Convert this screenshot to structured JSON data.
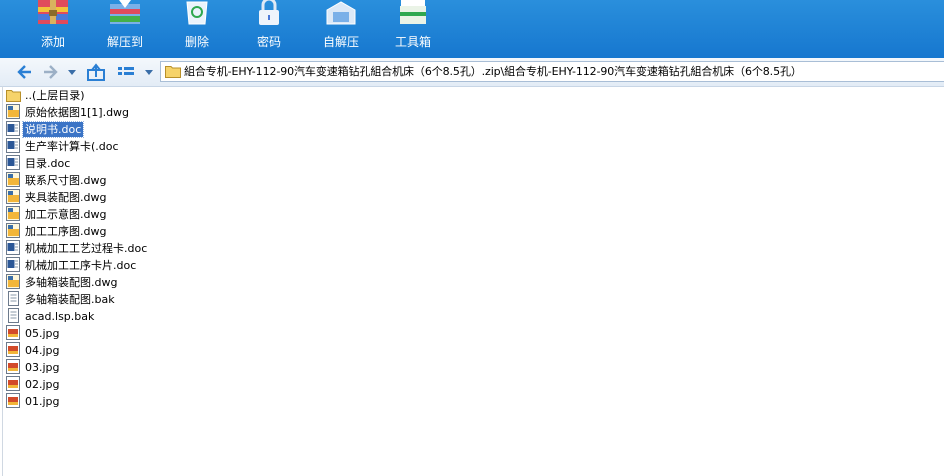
{
  "toolbar": {
    "buttons": [
      {
        "label": "添加",
        "icon": "add-archive-icon"
      },
      {
        "label": "解压到",
        "icon": "extract-icon"
      },
      {
        "label": "删除",
        "icon": "recycle-bin-icon"
      },
      {
        "label": "密码",
        "icon": "lock-icon"
      },
      {
        "label": "自解压",
        "icon": "self-extract-icon"
      },
      {
        "label": "工具箱",
        "icon": "toolbox-icon"
      }
    ]
  },
  "address": {
    "path": "組合专机-EHY-112-90汽车变速箱钻孔組合机床（6个8.5孔）.zip\\組合专机-EHY-112-90汽车变速箱钻孔組合机床（6个8.5孔）"
  },
  "files": [
    {
      "name": "..(上层目录)",
      "type": "parent-folder",
      "selected": false
    },
    {
      "name": "原始依据图1[1].dwg",
      "type": "dwg",
      "selected": false
    },
    {
      "name": "说明书.doc",
      "type": "doc",
      "selected": true
    },
    {
      "name": "生产率计算卡(.doc",
      "type": "doc",
      "selected": false
    },
    {
      "name": "目录.doc",
      "type": "doc",
      "selected": false
    },
    {
      "name": "联系尺寸图.dwg",
      "type": "dwg",
      "selected": false
    },
    {
      "name": "夹具装配图.dwg",
      "type": "dwg",
      "selected": false
    },
    {
      "name": "加工示意图.dwg",
      "type": "dwg",
      "selected": false
    },
    {
      "name": "加工工序图.dwg",
      "type": "dwg",
      "selected": false
    },
    {
      "name": "机械加工工艺过程卡.doc",
      "type": "doc",
      "selected": false
    },
    {
      "name": "机械加工工序卡片.doc",
      "type": "doc",
      "selected": false
    },
    {
      "name": "多轴箱装配图.dwg",
      "type": "dwg",
      "selected": false
    },
    {
      "name": "多轴箱装配图.bak",
      "type": "bak",
      "selected": false
    },
    {
      "name": "acad.lsp.bak",
      "type": "bak",
      "selected": false
    },
    {
      "name": "05.jpg",
      "type": "jpg",
      "selected": false
    },
    {
      "name": "04.jpg",
      "type": "jpg",
      "selected": false
    },
    {
      "name": "03.jpg",
      "type": "jpg",
      "selected": false
    },
    {
      "name": "02.jpg",
      "type": "jpg",
      "selected": false
    },
    {
      "name": "01.jpg",
      "type": "jpg",
      "selected": false
    }
  ]
}
